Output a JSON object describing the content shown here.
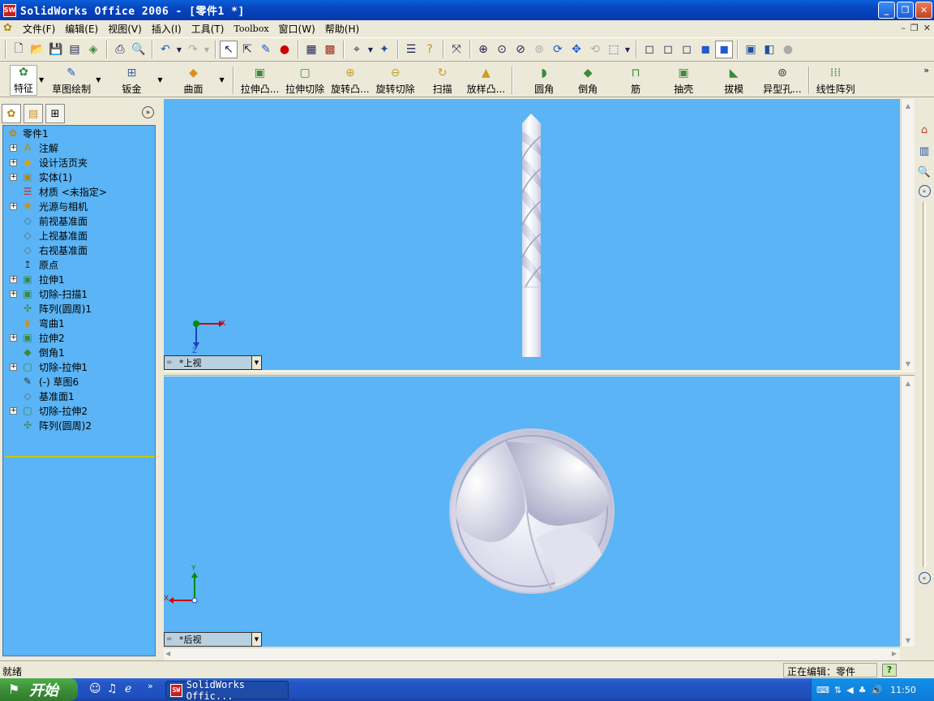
{
  "window": {
    "app_icon": "SW",
    "title": "SolidWorks Office 2006 - [零件1 *]",
    "btn_minimize": "_",
    "btn_restore": "❐",
    "btn_close": "✕"
  },
  "menu": {
    "items": [
      "文件(F)",
      "编辑(E)",
      "视图(V)",
      "插入(I)",
      "工具(T)",
      "Toolbox",
      "窗口(W)",
      "帮助(H)"
    ],
    "mdi": [
      "–",
      "❐",
      "✕"
    ]
  },
  "feature_toolbar": {
    "items": [
      "特征",
      "草图绘制",
      "钣金",
      "曲面",
      "拉伸凸...",
      "拉伸切除",
      "旋转凸...",
      "旋转切除",
      "扫描",
      "放样凸...",
      "圆角",
      "倒角",
      "筋",
      "抽壳",
      "拔模",
      "异型孔...",
      "线性阵列"
    ]
  },
  "tree": {
    "root": "零件1",
    "items": [
      "注解",
      "设计活页夹",
      "实体(1)",
      "材质 <未指定>",
      "光源与相机",
      "前视基准面",
      "上视基准面",
      "右视基准面",
      "原点",
      "拉伸1",
      "切除-扫描1",
      "阵列(圆周)1",
      "弯曲1",
      "拉伸2",
      "倒角1",
      "切除-拉伸1",
      "(-) 草图6",
      "基准面1",
      "切除-拉伸2",
      "阵列(圆周)2"
    ],
    "expand_symbol": "+"
  },
  "viewports": {
    "top": {
      "label": "*上视",
      "axis_h": "X",
      "axis_v": "Z"
    },
    "bottom": {
      "label": "*后视",
      "axis_h": "X",
      "axis_v": "Y"
    }
  },
  "status": {
    "left": "就绪",
    "right": "正在编辑：零件",
    "help": "?"
  },
  "taskbar": {
    "start": "开始",
    "task": "SolidWorks Offic...",
    "task_icon": "SW",
    "clock": "11:50"
  },
  "colors": {
    "viewport_bg": "#5ab4f5",
    "titlebar": "#0846c0",
    "taskbar": "#2456c5"
  }
}
